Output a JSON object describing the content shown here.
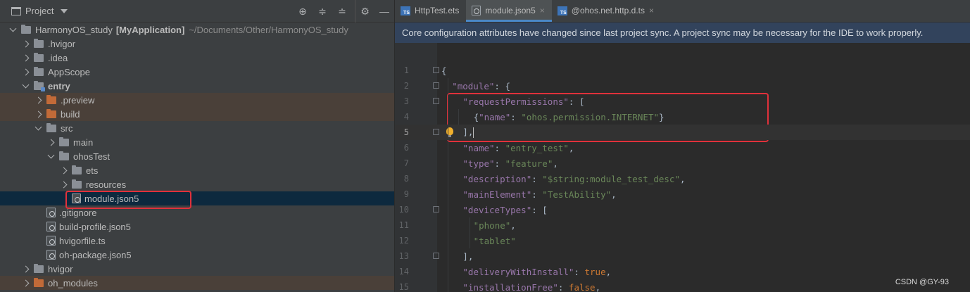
{
  "project_panel": {
    "title": "Project",
    "tools": [
      "crosshair-icon",
      "expand-all-icon",
      "collapse-all-icon",
      "gear-icon",
      "minimize-icon"
    ],
    "tree": [
      {
        "label": "HarmonyOS_study",
        "extra": "[MyApplication]",
        "path": "~/Documents/Other/HarmonyOS_study",
        "arrow": "down",
        "icon": "folder",
        "depth": 0
      },
      {
        "label": ".hvigor",
        "arrow": "right",
        "icon": "folder",
        "depth": 1
      },
      {
        "label": ".idea",
        "arrow": "right",
        "icon": "folder",
        "depth": 1
      },
      {
        "label": "AppScope",
        "arrow": "right",
        "icon": "folder",
        "depth": 1
      },
      {
        "label": "entry",
        "arrow": "down",
        "icon": "module",
        "depth": 1,
        "bold": true
      },
      {
        "label": ".preview",
        "arrow": "right",
        "icon": "orange",
        "depth": 2,
        "excluded": true
      },
      {
        "label": "build",
        "arrow": "right",
        "icon": "orange",
        "depth": 2,
        "excluded": true
      },
      {
        "label": "src",
        "arrow": "down",
        "icon": "folder",
        "depth": 2
      },
      {
        "label": "main",
        "arrow": "right",
        "icon": "folder",
        "depth": 3
      },
      {
        "label": "ohosTest",
        "arrow": "down",
        "icon": "folder",
        "depth": 3
      },
      {
        "label": "ets",
        "arrow": "right",
        "icon": "folder",
        "depth": 4
      },
      {
        "label": "resources",
        "arrow": "right",
        "icon": "folder",
        "depth": 4
      },
      {
        "label": "module.json5",
        "arrow": "none",
        "icon": "file",
        "depth": 4,
        "selected": true
      },
      {
        "label": ".gitignore",
        "arrow": "none",
        "icon": "file",
        "depth": 2
      },
      {
        "label": "build-profile.json5",
        "arrow": "none",
        "icon": "file",
        "depth": 2
      },
      {
        "label": "hvigorfile.ts",
        "arrow": "none",
        "icon": "file",
        "depth": 2
      },
      {
        "label": "oh-package.json5",
        "arrow": "none",
        "icon": "file",
        "depth": 2
      },
      {
        "label": "hvigor",
        "arrow": "right",
        "icon": "folder",
        "depth": 1
      },
      {
        "label": "oh_modules",
        "arrow": "right",
        "icon": "orange",
        "depth": 1,
        "excluded": true
      }
    ]
  },
  "editor": {
    "tabs": [
      {
        "label": "HttpTest.ets",
        "icon": "ts-file-icon",
        "closable": false
      },
      {
        "label": "module.json5",
        "icon": "config-file-icon",
        "closable": true,
        "active": true
      },
      {
        "label": "@ohos.net.http.d.ts",
        "icon": "ts-file-icon",
        "closable": true
      }
    ],
    "banner": "Core configuration attributes have changed since last project sync. A project sync may be necessary for the IDE to work properly.",
    "lines": [
      {
        "n": "1",
        "indent": 0,
        "tokens": [
          [
            "p",
            "{"
          ]
        ]
      },
      {
        "n": "2",
        "indent": 1,
        "tokens": [
          [
            "k",
            "\"module\""
          ],
          [
            "p",
            ": {"
          ]
        ]
      },
      {
        "n": "3",
        "indent": 2,
        "tokens": [
          [
            "k",
            "\"requestPermissions\""
          ],
          [
            "p",
            ": ["
          ]
        ]
      },
      {
        "n": "4",
        "indent": 3,
        "tokens": [
          [
            "p",
            "{"
          ],
          [
            "k",
            "\"name\""
          ],
          [
            "p",
            ": "
          ],
          [
            "s",
            "\"ohos.permission.INTERNET\""
          ],
          [
            "p",
            "}"
          ]
        ]
      },
      {
        "n": "5",
        "indent": 2,
        "tokens": [
          [
            "p",
            "],"
          ]
        ],
        "current": true
      },
      {
        "n": "6",
        "indent": 2,
        "tokens": [
          [
            "k",
            "\"name\""
          ],
          [
            "p",
            ": "
          ],
          [
            "s",
            "\"entry_test\""
          ],
          [
            "p",
            ","
          ]
        ]
      },
      {
        "n": "7",
        "indent": 2,
        "tokens": [
          [
            "k",
            "\"type\""
          ],
          [
            "p",
            ": "
          ],
          [
            "s",
            "\"feature\""
          ],
          [
            "p",
            ","
          ]
        ]
      },
      {
        "n": "8",
        "indent": 2,
        "tokens": [
          [
            "k",
            "\"description\""
          ],
          [
            "p",
            ": "
          ],
          [
            "s",
            "\"$string:module_test_desc\""
          ],
          [
            "p",
            ","
          ]
        ]
      },
      {
        "n": "9",
        "indent": 2,
        "tokens": [
          [
            "k",
            "\"mainElement\""
          ],
          [
            "p",
            ": "
          ],
          [
            "s",
            "\"TestAbility\""
          ],
          [
            "p",
            ","
          ]
        ]
      },
      {
        "n": "10",
        "indent": 2,
        "tokens": [
          [
            "k",
            "\"deviceTypes\""
          ],
          [
            "p",
            ": ["
          ]
        ]
      },
      {
        "n": "11",
        "indent": 3,
        "tokens": [
          [
            "s",
            "\"phone\""
          ],
          [
            "p",
            ","
          ]
        ]
      },
      {
        "n": "12",
        "indent": 3,
        "tokens": [
          [
            "s",
            "\"tablet\""
          ]
        ]
      },
      {
        "n": "13",
        "indent": 2,
        "tokens": [
          [
            "p",
            "],"
          ]
        ]
      },
      {
        "n": "14",
        "indent": 2,
        "tokens": [
          [
            "k",
            "\"deliveryWithInstall\""
          ],
          [
            "p",
            ": "
          ],
          [
            "kw",
            "true"
          ],
          [
            "p",
            ","
          ]
        ]
      },
      {
        "n": "15",
        "indent": 2,
        "tokens": [
          [
            "k",
            "\"installationFree\""
          ],
          [
            "p",
            ": "
          ],
          [
            "kw",
            "false"
          ],
          [
            "p",
            ","
          ]
        ]
      }
    ]
  },
  "watermark": "CSDN @GY-93",
  "colors": {
    "highlight_box": "#e0313b",
    "banner_bg": "#32435c",
    "selection": "#0d293e",
    "excluded": "#4a4039"
  }
}
